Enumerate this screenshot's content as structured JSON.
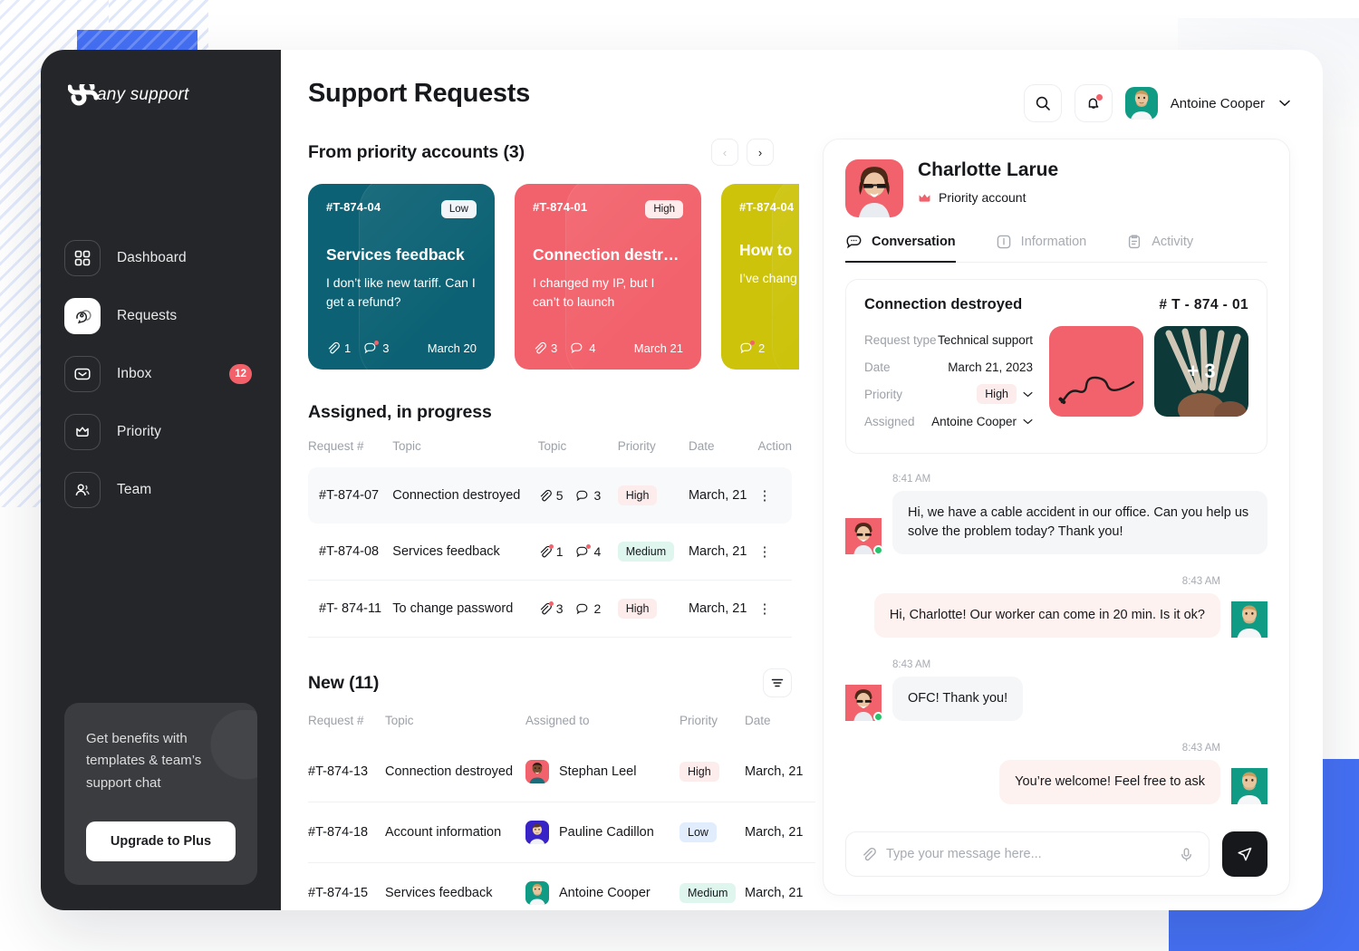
{
  "brand": {
    "name": "any support",
    "logo_icon": "s-curve-logo-icon"
  },
  "sidebar": {
    "items": [
      {
        "label": "Dashboard",
        "icon": "grid-icon",
        "badge": null,
        "active": false
      },
      {
        "label": "Requests",
        "icon": "requests-icon",
        "badge": null,
        "active": true
      },
      {
        "label": "Inbox",
        "icon": "envelope-icon",
        "badge": "12",
        "active": false
      },
      {
        "label": "Priority",
        "icon": "crown-icon",
        "badge": null,
        "active": false
      },
      {
        "label": "Team",
        "icon": "users-icon",
        "badge": null,
        "active": false
      }
    ],
    "promo": {
      "text": "Get benefits with templates & team’s support chat",
      "button_label": "Upgrade to Plus"
    }
  },
  "header": {
    "title": "Support Requests",
    "search_icon": "search-icon",
    "bell_icon": "bell-icon",
    "user_name": "Antoine Cooper",
    "chevron_icon": "chevron-down-icon"
  },
  "priority_section": {
    "title": "From priority accounts (3)",
    "prev_label": "‹",
    "next_label": "›",
    "cards": [
      {
        "id": "#T-874-04",
        "priority": "Low",
        "title": "Services feedback",
        "body": "I don’t like new tariff. Can I get a refund?",
        "attachments": "1",
        "comments": "3",
        "date": "March 20",
        "color": "#0c6274"
      },
      {
        "id": "#T-874-01",
        "priority": "High",
        "title": "Connection destro...",
        "body": "I changed my IP, but I can’t to launch",
        "attachments": "3",
        "comments": "4",
        "date": "March 21",
        "color": "#f2626c"
      },
      {
        "id": "#T-874-04",
        "priority": "",
        "title": "How to",
        "body": "I’ve chang How to de",
        "attachments": "",
        "comments": "2",
        "date": "",
        "color": "#ccc30a"
      }
    ]
  },
  "assigned_section": {
    "title": "Assigned, in progress",
    "columns": [
      "Request #",
      "Topic",
      "Topic",
      "Priority",
      "Date",
      "Action"
    ],
    "rows": [
      {
        "request": "#T-874-07",
        "topic": "Connection destroyed",
        "attachments": "5",
        "comments": "3",
        "priority": "High",
        "date": "March, 21",
        "highlight": true,
        "attach_alert": false,
        "comment_alert": false
      },
      {
        "request": "#T-874-08",
        "topic": "Services feedback",
        "attachments": "1",
        "comments": "4",
        "priority": "Medium",
        "date": "March, 21",
        "highlight": false,
        "attach_alert": true,
        "comment_alert": true
      },
      {
        "request": "#T- 874-11",
        "topic": "To change password",
        "attachments": "3",
        "comments": "2",
        "priority": "High",
        "date": "March, 21",
        "highlight": false,
        "attach_alert": true,
        "comment_alert": false
      }
    ]
  },
  "new_section": {
    "title": "New (11)",
    "filter_icon": "filter-icon",
    "columns": [
      "Request #",
      "Topic",
      "Assigned to",
      "Priority",
      "Date"
    ],
    "rows": [
      {
        "request": "#T-874-13",
        "topic": "Connection destroyed",
        "assignee": "Stephan Leel",
        "avatar_color": "#f2626c",
        "priority": "High",
        "date": "March, 21"
      },
      {
        "request": "#T-874-18",
        "topic": "Account information",
        "assignee": "Pauline Cadillon",
        "avatar_color": "#3823c6",
        "priority": "Low",
        "date": "March, 21"
      },
      {
        "request": "#T-874-15",
        "topic": "Services feedback",
        "assignee": "Antoine Cooper",
        "avatar_color": "#0f9b84",
        "priority": "Medium",
        "date": "March, 21"
      }
    ]
  },
  "conversation_panel": {
    "contact_name": "Charlotte Larue",
    "contact_badge": "Priority account",
    "crown_icon": "crown-icon",
    "tabs": [
      {
        "label": "Conversation",
        "icon": "chat-icon",
        "active": true
      },
      {
        "label": "Information",
        "icon": "info-icon",
        "active": false
      },
      {
        "label": "Activity",
        "icon": "clipboard-icon",
        "active": false
      }
    ],
    "request": {
      "title": "Connection destroyed",
      "number": "# T - 874 - 01",
      "fields": [
        {
          "label": "Request type",
          "value": "Technical support",
          "control": "none"
        },
        {
          "label": "Date",
          "value": "March 21, 2023",
          "control": "none"
        },
        {
          "label": "Priority",
          "value": "High",
          "control": "dropdown",
          "tag": "High"
        },
        {
          "label": "Assigned",
          "value": "Antoine Cooper",
          "control": "dropdown"
        }
      ],
      "thumbs": [
        {
          "kind": "cable-photo",
          "overlay": ""
        },
        {
          "kind": "cables-photo",
          "overlay": "+ 3"
        }
      ]
    },
    "messages": [
      {
        "time": "8:41 AM",
        "text": "Hi, we have a cable accident in our office. Can you help us solve the problem today? Thank you!",
        "side": "in",
        "online": true
      },
      {
        "time": "8:43 AM",
        "text": "Hi, Charlotte! Our worker can come in 20 min. Is it ok?",
        "side": "out",
        "online": false
      },
      {
        "time": "8:43 AM",
        "text": "OFC! Thank you!",
        "side": "in",
        "online": true
      },
      {
        "time": "8:43 AM",
        "text": "You’re welcome! Feel free to ask",
        "side": "out",
        "online": false
      }
    ],
    "composer": {
      "attach_icon": "paperclip-icon",
      "placeholder": "Type your message here...",
      "mic_icon": "microphone-icon",
      "send_icon": "send-icon"
    }
  },
  "colors": {
    "accent_blue": "#4570f4",
    "danger": "#f2626c",
    "sidebar": "#242629",
    "teal_card": "#0c6274",
    "yellow_card": "#ccc30a"
  }
}
